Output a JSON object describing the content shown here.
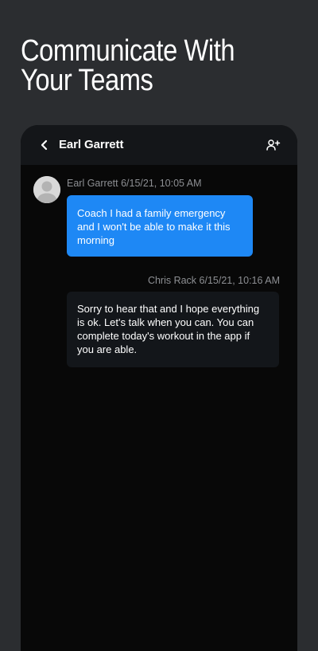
{
  "headline": {
    "line1": "Communicate With",
    "line2": "Your Teams"
  },
  "chat": {
    "contact_name": "Earl Garrett",
    "icons": {
      "back": "chevron-left-icon",
      "add_person": "person-add-icon",
      "avatar": "avatar-placeholder"
    },
    "messages": [
      {
        "meta": "Earl Garrett 6/15/21, 10:05 AM",
        "text": "Coach I had a family emergency and I won't be able to make it this morning",
        "direction": "incoming"
      },
      {
        "meta": "Chris Rack 6/15/21, 10:16 AM",
        "text": "Sorry to hear that and I hope everything is ok. Let's talk when you can. You can complete today's workout in the app if you are able.",
        "direction": "outgoing"
      }
    ]
  },
  "colors": {
    "background": "#2b2d30",
    "phone_screen": "#080808",
    "topbar": "#141619",
    "incoming_bubble": "#1e88f5",
    "outgoing_bubble": "#13161a",
    "meta_text": "#8d8f93"
  }
}
